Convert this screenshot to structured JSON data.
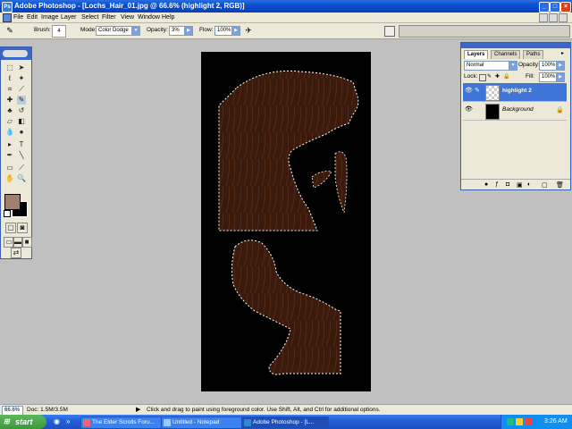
{
  "window": {
    "title": "Adobe Photoshop - [Lochs_Hair_01.jpg @ 66.6% (highlight 2, RGB)]",
    "controls": [
      "_",
      "□",
      "×"
    ]
  },
  "menu": [
    "File",
    "Edit",
    "Image",
    "Layer",
    "Select",
    "Filter",
    "View",
    "Window",
    "Help"
  ],
  "options": {
    "brush_label": "Brush:",
    "brush_size": "4",
    "mode_label": "Mode:",
    "mode_value": "Color Dodge",
    "opacity_label": "Opacity:",
    "opacity_value": "3%",
    "flow_label": "Flow:",
    "flow_value": "100%"
  },
  "layers_panel": {
    "tabs": [
      "Layers",
      "Channels",
      "Paths"
    ],
    "blend_mode": "Normal",
    "opacity_label": "Opacity:",
    "opacity_value": "100%",
    "lock_label": "Lock:",
    "fill_label": "Fill:",
    "fill_value": "100%",
    "layers": [
      {
        "name": "highlight 2",
        "selected": true
      },
      {
        "name": "Background",
        "selected": false
      }
    ]
  },
  "status": {
    "zoom": "66.6%",
    "doc": "Doc: 1.5M/3.5M",
    "hint": "Click and drag to paint using foreground color.  Use Shift, Alt, and Ctrl for additional options."
  },
  "taskbar": {
    "start": "start",
    "tasks": [
      {
        "label": "The Elder Scrolls Foru...",
        "active": false
      },
      {
        "label": "Untitled - Notepad",
        "active": false
      },
      {
        "label": "Adobe Photoshop - [L...",
        "active": true
      }
    ],
    "clock": "3:26 AM"
  },
  "colors": {
    "foreground": "#a08070",
    "background": "#000000",
    "hair": "#3a1a0c"
  }
}
